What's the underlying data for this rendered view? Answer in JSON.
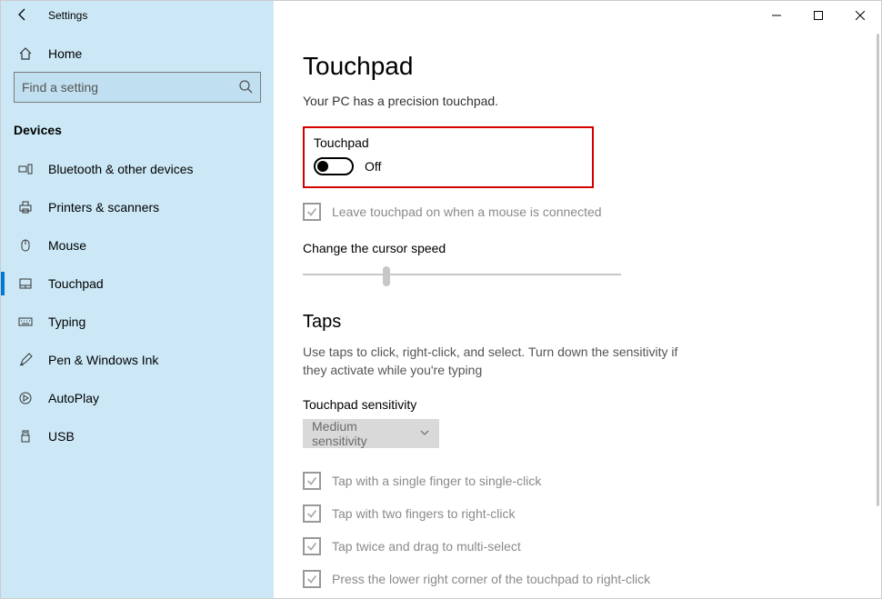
{
  "window": {
    "title": "Settings"
  },
  "sidebar": {
    "home_label": "Home",
    "search_placeholder": "Find a setting",
    "category_label": "Devices",
    "items": [
      {
        "label": "Bluetooth & other devices"
      },
      {
        "label": "Printers & scanners"
      },
      {
        "label": "Mouse"
      },
      {
        "label": "Touchpad"
      },
      {
        "label": "Typing"
      },
      {
        "label": "Pen & Windows Ink"
      },
      {
        "label": "AutoPlay"
      },
      {
        "label": "USB"
      }
    ]
  },
  "main": {
    "page_title": "Touchpad",
    "precision_text": "Your PC has a precision touchpad.",
    "toggle_section_label": "Touchpad",
    "toggle_state": "Off",
    "leave_on_label": "Leave touchpad on when a mouse is connected",
    "cursor_speed_label": "Change the cursor speed",
    "cursor_speed_value": 3,
    "cursor_speed_max": 10,
    "taps_header": "Taps",
    "taps_desc": "Use taps to click, right-click, and select. Turn down the sensitivity if they activate while you're typing",
    "sensitivity_label": "Touchpad sensitivity",
    "sensitivity_value": "Medium sensitivity",
    "tap_options": [
      "Tap with a single finger to single-click",
      "Tap with two fingers to right-click",
      "Tap twice and drag to multi-select",
      "Press the lower right corner of the touchpad to right-click"
    ]
  }
}
